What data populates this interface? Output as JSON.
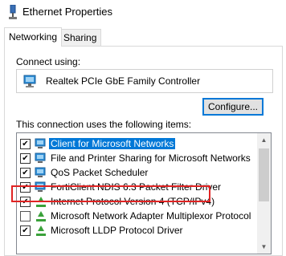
{
  "window": {
    "title": "Ethernet Properties",
    "icon": "network-adapter-icon"
  },
  "tabs": [
    {
      "label": "Networking",
      "active": true
    },
    {
      "label": "Sharing",
      "active": false
    }
  ],
  "connect": {
    "label": "Connect using:",
    "adapter_name": "Realtek PCIe GbE Family Controller",
    "adapter_icon": "network-card-icon"
  },
  "configure_button": "Configure...",
  "items_label": "This connection uses the following items:",
  "items": [
    {
      "label": "Client for Microsoft Networks",
      "checked": true,
      "icon": "client-network-icon",
      "selected": true
    },
    {
      "label": "File and Printer Sharing for Microsoft Networks",
      "checked": true,
      "icon": "printer-sharing-icon",
      "selected": false
    },
    {
      "label": "QoS Packet Scheduler",
      "checked": true,
      "icon": "service-icon",
      "selected": false
    },
    {
      "label": "FortiClient NDIS 6.3 Packet Filter Driver",
      "checked": true,
      "icon": "service-icon",
      "selected": false
    },
    {
      "label": "Internet Protocol Version 4 (TCP/IPv4)",
      "checked": true,
      "icon": "protocol-icon",
      "selected": false,
      "highlighted": true
    },
    {
      "label": "Microsoft Network Adapter Multiplexor Protocol",
      "checked": false,
      "icon": "protocol-icon",
      "selected": false
    },
    {
      "label": "Microsoft LLDP Protocol Driver",
      "checked": true,
      "icon": "protocol-icon",
      "selected": false
    }
  ],
  "colors": {
    "selection": "#0078d7",
    "highlight_border": "#e02424",
    "protocol_green": "#3aa13a"
  }
}
